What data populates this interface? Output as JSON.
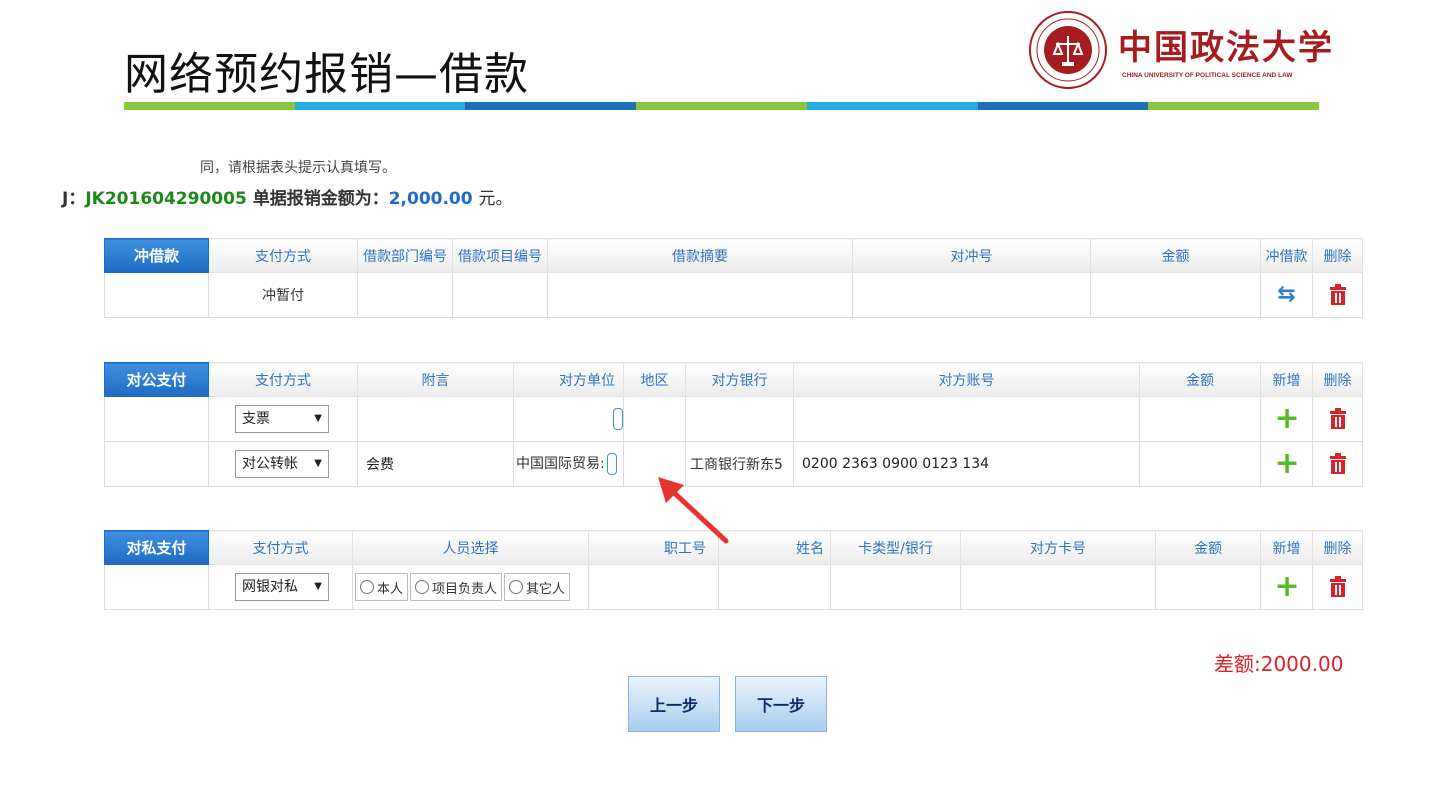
{
  "slide": {
    "title": "网络预约报销—借款",
    "bar_colors": [
      "#8cc63f",
      "#27aae1",
      "#1a6fb5",
      "#8cc63f",
      "#27aae1",
      "#1a6fb5",
      "#8cc63f"
    ]
  },
  "logo": {
    "name": "中国政法大学",
    "subtitle": "CHINA UNIVERSITY OF POLITICAL SCIENCE AND LAW",
    "emblem_text": "法",
    "color": "#a51d20"
  },
  "notice": "同，请根据表头提示认真填写。",
  "doc": {
    "prefix": "J：",
    "number": "JK201604290005",
    "amount_label": "单据报销金额为：",
    "amount": "2,000.00",
    "unit": "元。"
  },
  "loan_offset": {
    "section_label": "冲借款",
    "headers": [
      "支付方式",
      "借款部门编号",
      "借款项目编号",
      "借款摘要",
      "对冲号",
      "金额",
      "冲借款",
      "删除"
    ],
    "rows": [
      {
        "pay_method": "冲暂付"
      }
    ]
  },
  "public_payment": {
    "section_label": "对公支付",
    "headers": [
      "支付方式",
      "附言",
      "对方单位",
      "地区",
      "对方银行",
      "对方账号",
      "金额",
      "新增",
      "删除"
    ],
    "rows": [
      {
        "pay_method": "支票",
        "memo": "",
        "payee": "",
        "region": "",
        "bank": "",
        "account": "",
        "amount": ""
      },
      {
        "pay_method": "对公转帐",
        "memo": "会费",
        "payee": "中国国际贸易:",
        "region": "",
        "bank": "工商银行新东5",
        "account": "0200 2363 0900 0123 134",
        "amount": ""
      }
    ]
  },
  "private_payment": {
    "section_label": "对私支付",
    "headers": [
      "支付方式",
      "人员选择",
      "职工号",
      "姓名",
      "卡类型/银行",
      "对方卡号",
      "金额",
      "新增",
      "删除"
    ],
    "rows": [
      {
        "pay_method": "网银对私",
        "options": [
          "本人",
          "项目负责人",
          "其它人"
        ]
      }
    ]
  },
  "difference": "差额:2000.00",
  "buttons": {
    "prev": "上一步",
    "next": "下一步"
  },
  "icons": {
    "add": "plus-icon",
    "delete": "trash-icon",
    "offset": "swap-arrows-icon",
    "dropdown": "caret-down-icon"
  }
}
